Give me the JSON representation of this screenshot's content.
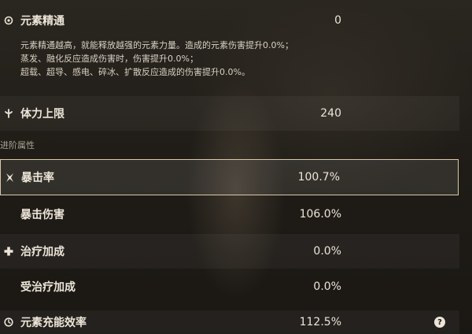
{
  "stats": {
    "elemental_mastery": {
      "label": "元素精通",
      "value": "0",
      "desc_line1": "元素精通越高，就能释放越强的元素力量。造成的元素伤害提升0.0%；",
      "desc_line2": "蒸发、融化反应造成伤害时，伤害提升0.0%；",
      "desc_line3": "超载、超导、感电、碎冰、扩散反应造成的伤害提升0.0%。"
    },
    "max_stamina": {
      "label": "体力上限",
      "value": "240"
    }
  },
  "advanced": {
    "section_title": "进阶属性",
    "crit_rate": {
      "label": "暴击率",
      "value": "100.7%"
    },
    "crit_dmg": {
      "label": "暴击伤害",
      "value": "106.0%"
    },
    "healing_bonus": {
      "label": "治疗加成",
      "value": "0.0%"
    },
    "incoming_healing": {
      "label": "受治疗加成",
      "value": "0.0%"
    },
    "energy_recharge": {
      "label": "元素充能效率",
      "value": "112.5%"
    }
  },
  "icons": {
    "elemental_mastery": "atom-icon",
    "max_stamina": "stamina-icon",
    "crit_rate": "crit-icon",
    "healing_bonus": "plus-icon",
    "energy_recharge": "energy-icon",
    "help": "help-icon"
  },
  "help_glyph": "?"
}
